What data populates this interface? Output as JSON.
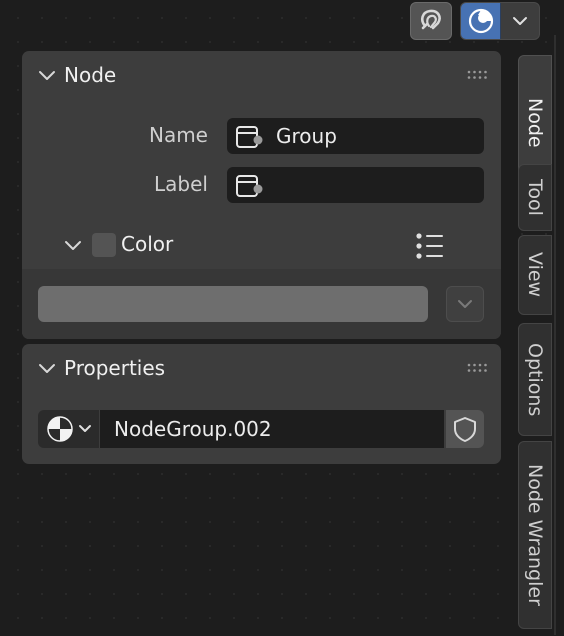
{
  "toolbar": {
    "overlay_icon": "magnet-icon",
    "gizmo_icon": "viewport-gizmo-icon",
    "gizmo_dropdown_icon": "chevron-down-icon"
  },
  "node_panel": {
    "title": "Node",
    "name_label": "Name",
    "name_value": "Group",
    "label_label": "Label",
    "label_value": "",
    "color_label": "Color",
    "color_enabled": false,
    "color_swatch": "#6e6e6e"
  },
  "properties_panel": {
    "title": "Properties",
    "node_group_value": "NodeGroup.002"
  },
  "sidebar_tabs": [
    {
      "label": "Node",
      "active": true
    },
    {
      "label": "Tool",
      "active": false
    },
    {
      "label": "View",
      "active": false
    },
    {
      "label": "Options",
      "active": false
    },
    {
      "label": "Node Wrangler",
      "active": false
    }
  ],
  "colors": {
    "background": "#1d1d1d",
    "panel": "#3d3d3d",
    "field": "#1d1d1d",
    "accent": "#4772b3"
  }
}
